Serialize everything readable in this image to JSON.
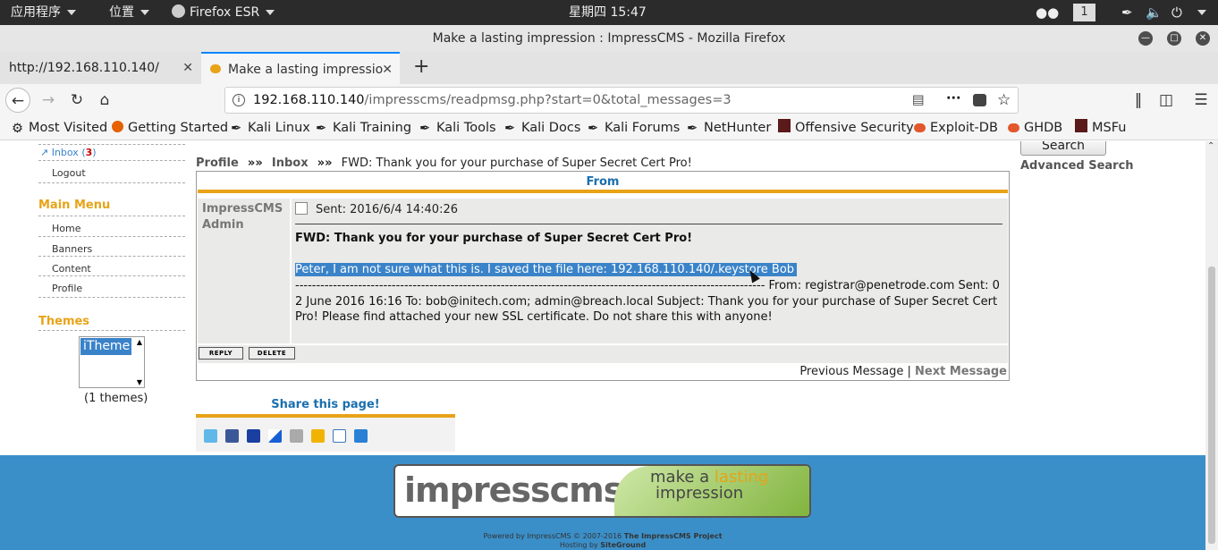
{
  "topbar": {
    "apps": "应用程序",
    "places": "位置",
    "firefox": "Firefox ESR",
    "clock": "星期四 15:47",
    "workspace": "1"
  },
  "window": {
    "title": "Make a lasting impression : ImpressCMS - Mozilla Firefox"
  },
  "tabs": [
    {
      "label": "http://192.168.110.140/"
    },
    {
      "label": "Make a lasting impressio"
    }
  ],
  "url": {
    "host": "192.168.110.140",
    "path": "/impresscms/readpmsg.php?start=0&total_messages=3"
  },
  "bookmarks": [
    "Most Visited",
    "Getting Started",
    "Kali Linux",
    "Kali Training",
    "Kali Tools",
    "Kali Docs",
    "Kali Forums",
    "NetHunter",
    "Offensive Security",
    "Exploit-DB",
    "GHDB",
    "MSFu"
  ],
  "sidebar": {
    "inbox_label": "Inbox",
    "inbox_count": "3",
    "logout": "Logout",
    "main_menu_heading": "Main Menu",
    "menu_items": [
      "Home",
      "Banners",
      "Content",
      "Profile"
    ],
    "themes_heading": "Themes",
    "theme_option": "iTheme",
    "themes_count": "(1 themes)"
  },
  "search": {
    "button": "Search",
    "advanced": "Advanced Search"
  },
  "breadcrumb": {
    "profile": "Profile",
    "sep": "»»",
    "inbox": "Inbox",
    "current": "FWD: Thank you for your purchase of Super Secret Cert Pro!"
  },
  "message": {
    "header": "From",
    "sender": "ImpressCMS Admin",
    "sent": "Sent: 2016/6/4 14:40:26",
    "subject": "FWD: Thank you for your purchase of Super Secret Cert Pro!",
    "highlighted": "Peter, I am not sure what this is. I saved the file here: 192.168.110.140/.keystore Bob",
    "body": "---------------------------------------------------------------------------------------------------------------- From: registrar@penetrode.com Sent: 02 June 2016 16:16 To: bob@initech.com; admin@breach.local Subject: Thank you for your purchase of Super Secret Cert Pro! Please find attached your new SSL certificate. Do not share this with anyone!",
    "reply": "REPLY",
    "delete": "DELETE",
    "prev": "Previous Message",
    "divider": "|",
    "next": "Next Message"
  },
  "share": {
    "heading": "Share this page!"
  },
  "footer": {
    "logo_left": "impresscms",
    "logo_right1": "make a ",
    "logo_right_lasting": "lasting",
    "logo_right2": "impression",
    "powered": "Powered by ImpressCMS © 2007-2016 ",
    "project": "The ImpressCMS Project",
    "hosting": "Hosting by ",
    "host": "SiteGround"
  },
  "colors": {
    "accent": "#e8a317",
    "link": "#0066aa",
    "footer": "#3b8fc8",
    "highlight": "#3a83c9"
  }
}
